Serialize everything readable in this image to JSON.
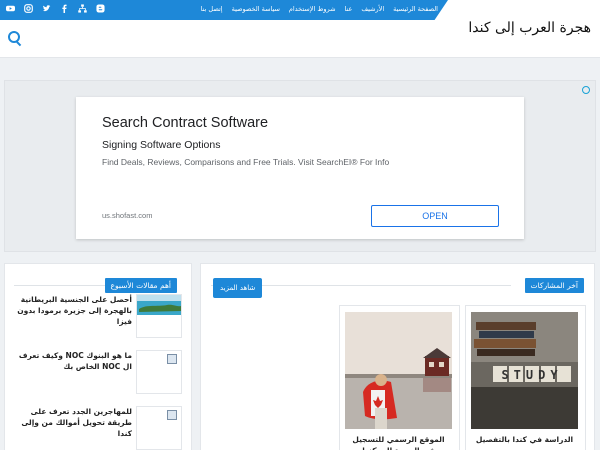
{
  "topnav": {
    "items": [
      "الصفحة الرئيسية",
      "الأرشيف",
      "عنا",
      "شروط الإستخدام",
      "سياسة الخصوصية",
      "إتصل بنا"
    ]
  },
  "social": {
    "icons": [
      "youtube-icon",
      "instagram-icon",
      "twitter-icon",
      "facebook-icon",
      "sitemap-icon",
      "blogger-icon"
    ]
  },
  "header": {
    "title": "هجرة العرب إلى كندا"
  },
  "ad": {
    "title": "Search Contract Software",
    "subtitle": "Signing Software Options",
    "description": "Find Deals, Reviews, Comparisons and Free Trials. Visit SearchEI® For Info",
    "url": "us.shofast.com",
    "button": "OPEN"
  },
  "main": {
    "section_title": "آخر المشاركات",
    "more_label": "شاهد المزيد",
    "cards": [
      {
        "title": "الدراسة في كندا بالتفصيل"
      },
      {
        "title": "الموقع الرسمي للتسجيل في الهجرة إلى كندا"
      }
    ]
  },
  "sidebar": {
    "section_title": "أهم مقالات الأسبوع",
    "items": [
      {
        "title": "أحصل على الجنسية البريطانية بالهجرة إلى جزيرة برمودا بدون فيزا"
      },
      {
        "title": "ما هو البنوك NOC وكيف تعرف ال NOC الخاص بك"
      },
      {
        "title": "للمهاجرين الجدد تعرف على طريقة تحويل أموالك من وإلى كندا"
      }
    ]
  },
  "colors": {
    "accent": "#1e88d8",
    "background": "#eef1f4"
  }
}
